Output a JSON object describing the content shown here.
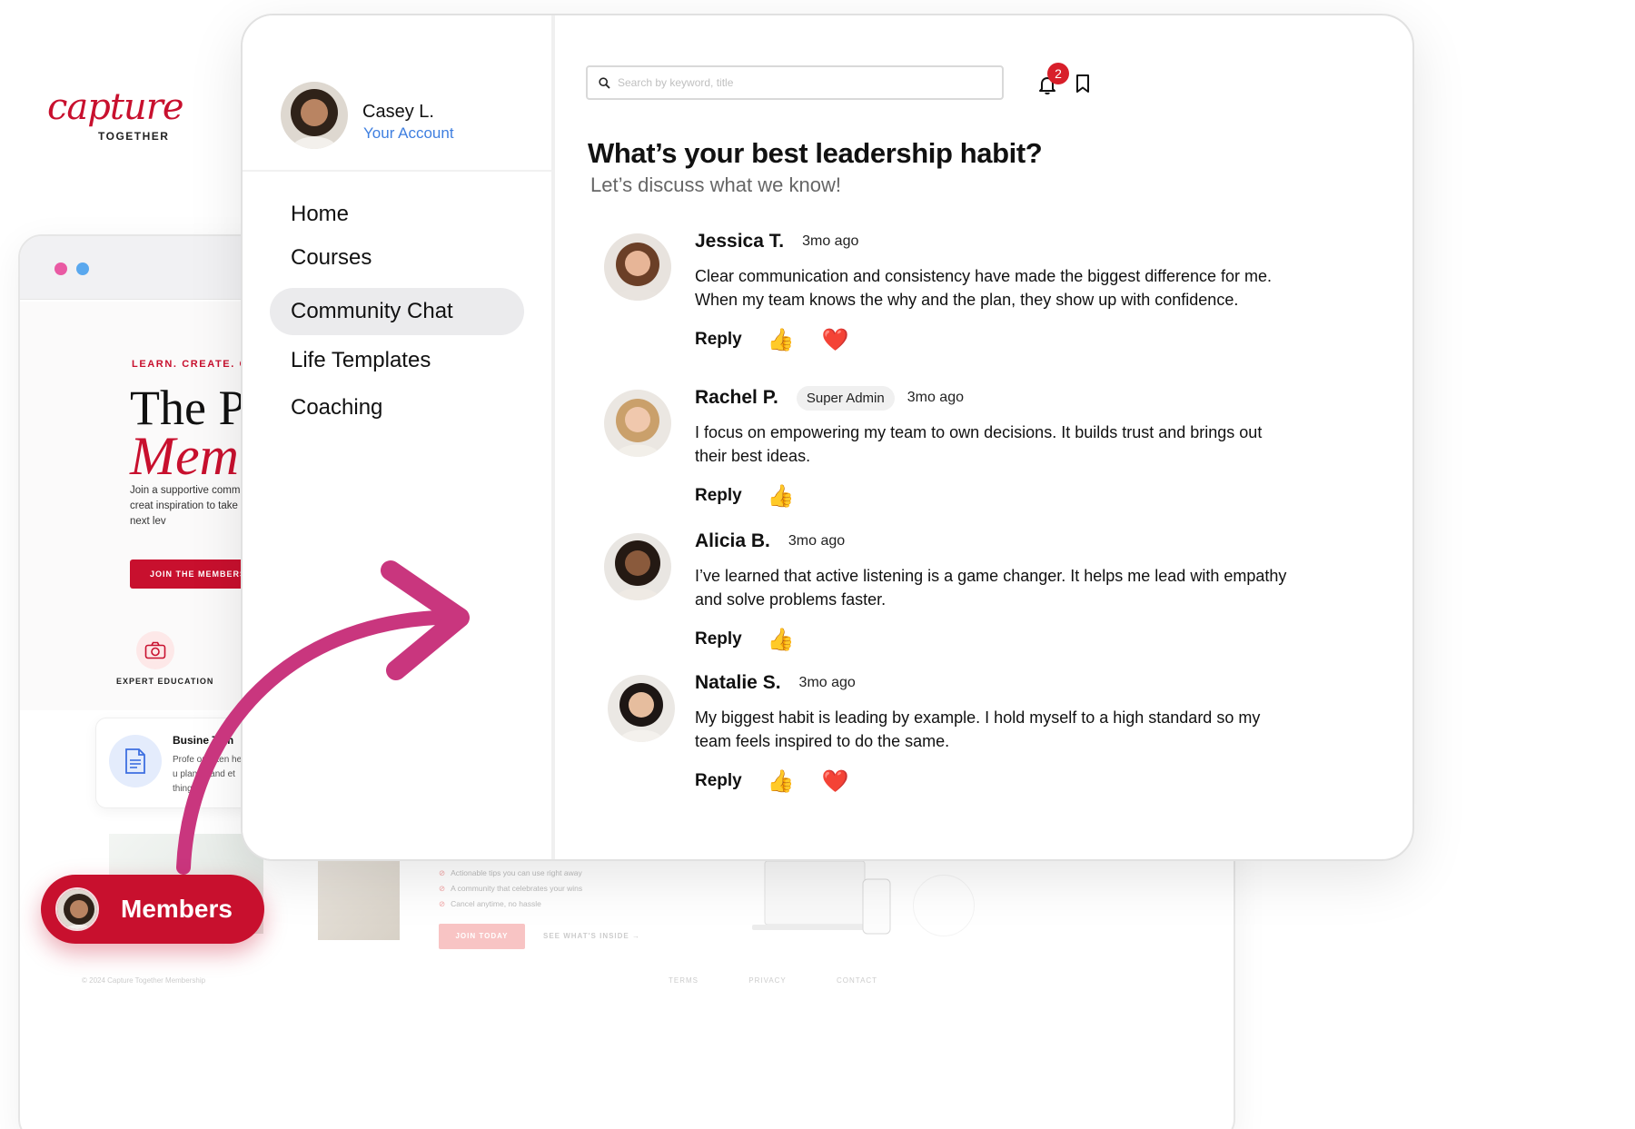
{
  "background_site": {
    "brand_script": "capture",
    "brand_sub": "TOGETHER",
    "tagline": "LEARN. CREATE. GROW",
    "hero_line1": "The Pl",
    "hero_line2": "Mem",
    "hero_body": "Join a supportive comm expert education, creat inspiration to take your business to the next lev",
    "hero_button": "JOIN THE MEMBERSHI",
    "feature_label": "EXPERT EDUCATION",
    "card_title": "Busine   Tem",
    "card_text": "Profe   onal ten help   u plan, o and   et things c",
    "checklist": [
      "Actionable tips you can use right away",
      "A community that celebrates your wins",
      "Cancel anytime, no hassle"
    ],
    "join_button": "JOIN TODAY",
    "see_link": "SEE WHAT'S INSIDE →",
    "footer_copyright": "© 2024 Capture Together Membership",
    "footer_links": [
      "TERMS",
      "PRIVACY",
      "CONTACT"
    ]
  },
  "app": {
    "profile": {
      "name": "Casey L.",
      "account_link": "Your Account"
    },
    "nav": [
      {
        "label": "Home",
        "active": false
      },
      {
        "label": "Courses",
        "active": false
      },
      {
        "label": "Community Chat",
        "active": true
      },
      {
        "label": "Life Templates",
        "active": false
      },
      {
        "label": "Coaching",
        "active": false
      }
    ],
    "search": {
      "placeholder": "Search by keyword, title"
    },
    "notifications": {
      "count": "2"
    },
    "thread": {
      "title": "What’s your best leadership habit?",
      "subtitle": "Let’s discuss what we know!"
    },
    "posts": [
      {
        "author": "Jessica T.",
        "role": "",
        "time": "3mo ago",
        "text": "Clear communication and consistency have made the biggest difference for me. When my team knows the why and the plan, they show up with confidence.",
        "reply_label": "Reply",
        "reactions": [
          "👍",
          "❤️"
        ]
      },
      {
        "author": "Rachel P.",
        "role": "Super Admin",
        "time": "3mo ago",
        "text": "I focus on empowering my team to own decisions. It builds trust and brings out their best ideas.",
        "reply_label": "Reply",
        "reactions": [
          "👍"
        ]
      },
      {
        "author": "Alicia B.",
        "role": "",
        "time": "3mo ago",
        "text": "I’ve learned that active listening is a game changer. It helps me lead with empathy and solve problems faster.",
        "reply_label": "Reply",
        "reactions": [
          "👍"
        ]
      },
      {
        "author": "Natalie S.",
        "role": "",
        "time": "3mo ago",
        "text": "My biggest habit is leading by example. I hold myself to a high standard so my team feels inspired to do the same.",
        "reply_label": "Reply",
        "reactions": [
          "👍",
          "❤️"
        ]
      }
    ]
  },
  "members_button": {
    "label": "Members"
  },
  "colors": {
    "brand_red": "#c8102e",
    "arrow_magenta": "#c9367e",
    "link_blue": "#3f7fe0",
    "notif_red": "#d81f2a"
  }
}
